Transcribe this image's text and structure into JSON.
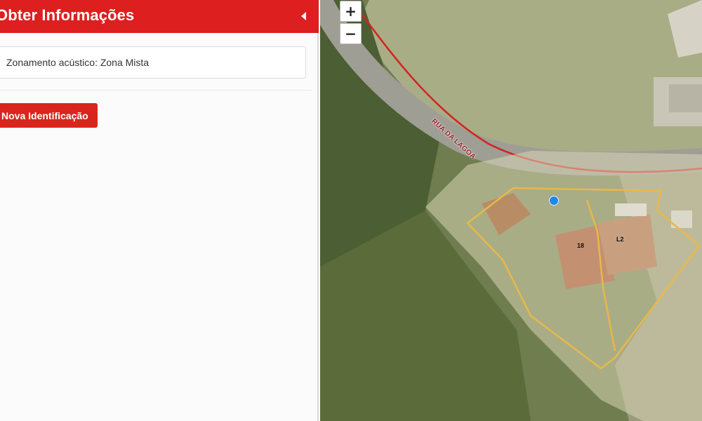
{
  "panel": {
    "title": "Obter Informações",
    "collapse_icon": "caret-left-icon",
    "info_text": "Zonamento acústico: Zona Mista",
    "new_identification_label": "Nova Identificação"
  },
  "map": {
    "zoom_in_label": "+",
    "zoom_out_label": "−",
    "street_name": "RUA DA LAGOA",
    "parcel_labels": [
      "18",
      "L2"
    ],
    "marker_icon": "location-dot-icon"
  },
  "colors": {
    "brand_red": "#dd1f1f",
    "road_line": "#d42222",
    "parcel_outline": "#e8b84a",
    "marker_blue": "#1e88e5"
  }
}
